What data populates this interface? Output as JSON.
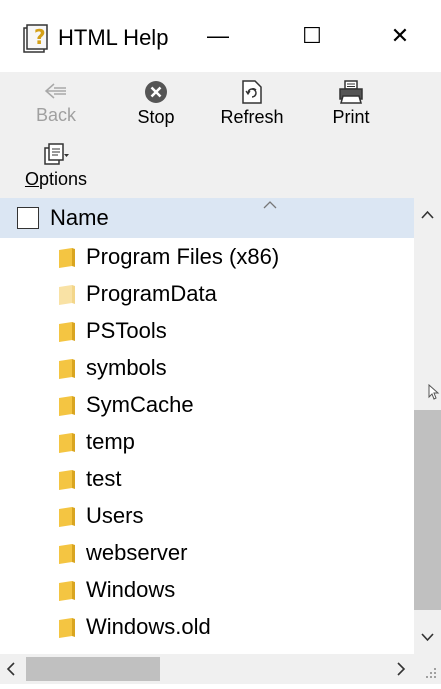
{
  "window": {
    "title": "HTML Help",
    "minimize_glyph": "—",
    "maximize_glyph": "☐",
    "close_glyph": "✕"
  },
  "toolbar": {
    "back_label": "Back",
    "stop_label": "Stop",
    "refresh_label": "Refresh",
    "print_label": "Print",
    "options_label": "Options"
  },
  "list": {
    "header_label": "Name",
    "items": [
      {
        "label": "Program Files (x86)",
        "faded": false
      },
      {
        "label": "ProgramData",
        "faded": true
      },
      {
        "label": "PSTools",
        "faded": false
      },
      {
        "label": "symbols",
        "faded": false
      },
      {
        "label": "SymCache",
        "faded": false
      },
      {
        "label": "temp",
        "faded": false
      },
      {
        "label": "test",
        "faded": false
      },
      {
        "label": "Users",
        "faded": false
      },
      {
        "label": "webserver",
        "faded": false
      },
      {
        "label": "Windows",
        "faded": false
      },
      {
        "label": "Windows.old",
        "faded": false
      }
    ]
  },
  "colors": {
    "header_bg": "#dbe6f3",
    "folder": "#f4c542",
    "folder_faded": "#f9e2a5",
    "toolbar_bg": "#f0f0f0"
  },
  "icons": [
    "help-book-icon",
    "back-arrow-icon",
    "stop-icon",
    "refresh-icon",
    "print-icon",
    "options-icon",
    "folder-icon",
    "sort-up-icon",
    "scroll-up-icon",
    "scroll-down-icon",
    "scroll-left-icon",
    "scroll-right-icon",
    "size-grip-icon",
    "mouse-cursor-icon"
  ]
}
